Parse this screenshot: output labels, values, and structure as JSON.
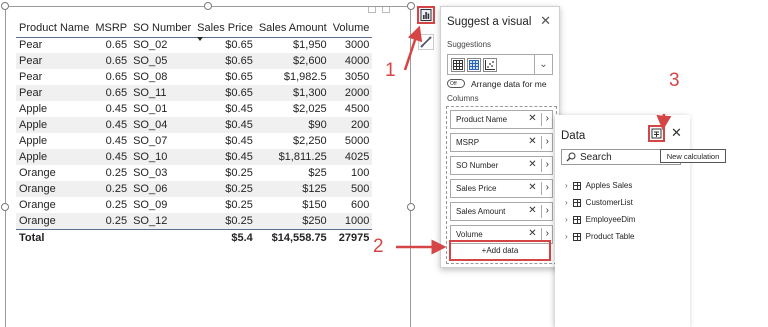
{
  "table": {
    "columns": [
      "Product Name",
      "MSRP",
      "SO Number",
      "Sales Price",
      "Sales Amount",
      "Volume"
    ],
    "rows": [
      [
        "Pear",
        "0.65",
        "SO_02",
        "$0.65",
        "$1,950",
        "3000"
      ],
      [
        "Pear",
        "0.65",
        "SO_05",
        "$0.65",
        "$2,600",
        "4000"
      ],
      [
        "Pear",
        "0.65",
        "SO_08",
        "$0.65",
        "$1,982.5",
        "3050"
      ],
      [
        "Pear",
        "0.65",
        "SO_11",
        "$0.65",
        "$1,300",
        "2000"
      ],
      [
        "Apple",
        "0.45",
        "SO_01",
        "$0.45",
        "$2,025",
        "4500"
      ],
      [
        "Apple",
        "0.45",
        "SO_04",
        "$0.45",
        "$90",
        "200"
      ],
      [
        "Apple",
        "0.45",
        "SO_07",
        "$0.45",
        "$2,250",
        "5000"
      ],
      [
        "Apple",
        "0.45",
        "SO_10",
        "$0.45",
        "$1,811.25",
        "4025"
      ],
      [
        "Orange",
        "0.25",
        "SO_03",
        "$0.25",
        "$25",
        "100"
      ],
      [
        "Orange",
        "0.25",
        "SO_06",
        "$0.25",
        "$125",
        "500"
      ],
      [
        "Orange",
        "0.25",
        "SO_09",
        "$0.25",
        "$150",
        "600"
      ],
      [
        "Orange",
        "0.25",
        "SO_12",
        "$0.25",
        "$250",
        "1000"
      ]
    ],
    "total": [
      "Total",
      "",
      "",
      "$5.4",
      "$14,558.75",
      "27975"
    ]
  },
  "suggest": {
    "title": "Suggest a visual",
    "suggestions_label": "Suggestions",
    "toggle_state": "Off",
    "arrange_label": "Arrange data for me",
    "columns_label": "Columns",
    "columns": [
      "Product Name",
      "MSRP",
      "SO Number",
      "Sales Price",
      "Sales Amount",
      "Volume"
    ],
    "add_data": "+Add data"
  },
  "data_pane": {
    "title": "Data",
    "search_placeholder": "Search",
    "tooltip": "New calculation",
    "tables": [
      "Apples Sales",
      "CustomerList",
      "EmployeeDim",
      "Product Table"
    ]
  },
  "annotations": [
    "1",
    "2",
    "3"
  ],
  "colors": {
    "highlight": "#d64545",
    "header_rule": "#5b6e8c",
    "stripe": "#f0f0f0"
  }
}
